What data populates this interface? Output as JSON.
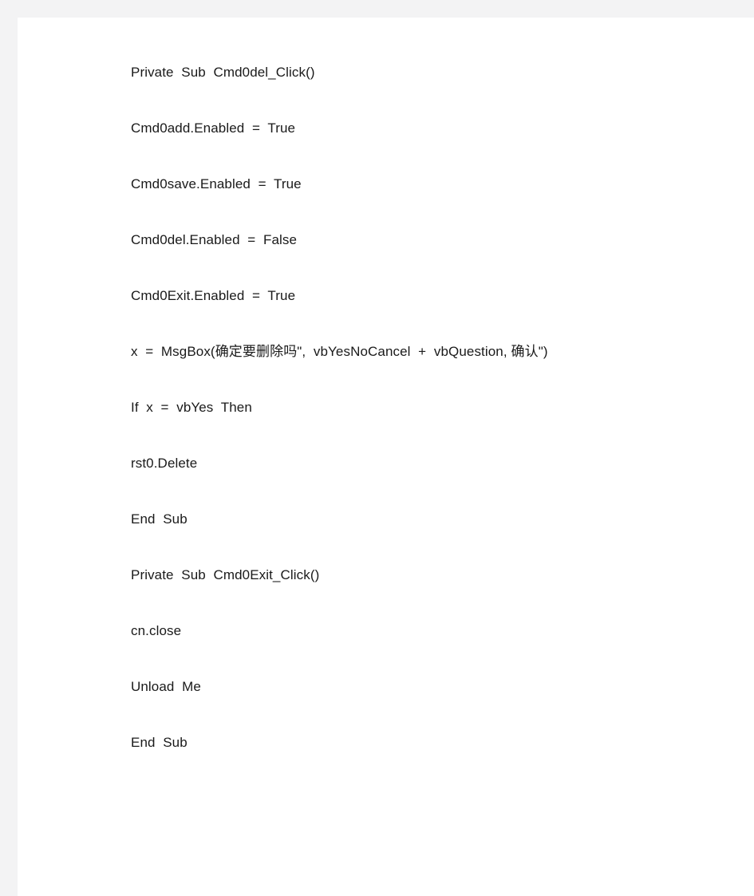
{
  "document": {
    "page_background": "#ffffff",
    "margin_background": "#f3f3f4",
    "text_color": "#1a1a1a",
    "language": "VBA"
  },
  "code": {
    "lines": [
      "Private  Sub  Cmd0del_Click()",
      "Cmd0add.Enabled  =  True",
      "Cmd0save.Enabled  =  True",
      "Cmd0del.Enabled  =  False",
      "Cmd0Exit.Enabled  =  True",
      "x  =  MsgBox(确定要删除吗\",  vbYesNoCancel  +  vbQuestion, 确认\")",
      "If  x  =  vbYes  Then",
      "rst0.Delete",
      "End  Sub",
      "Private  Sub  Cmd0Exit_Click()",
      "cn.close",
      "Unload  Me",
      "End  Sub"
    ]
  }
}
